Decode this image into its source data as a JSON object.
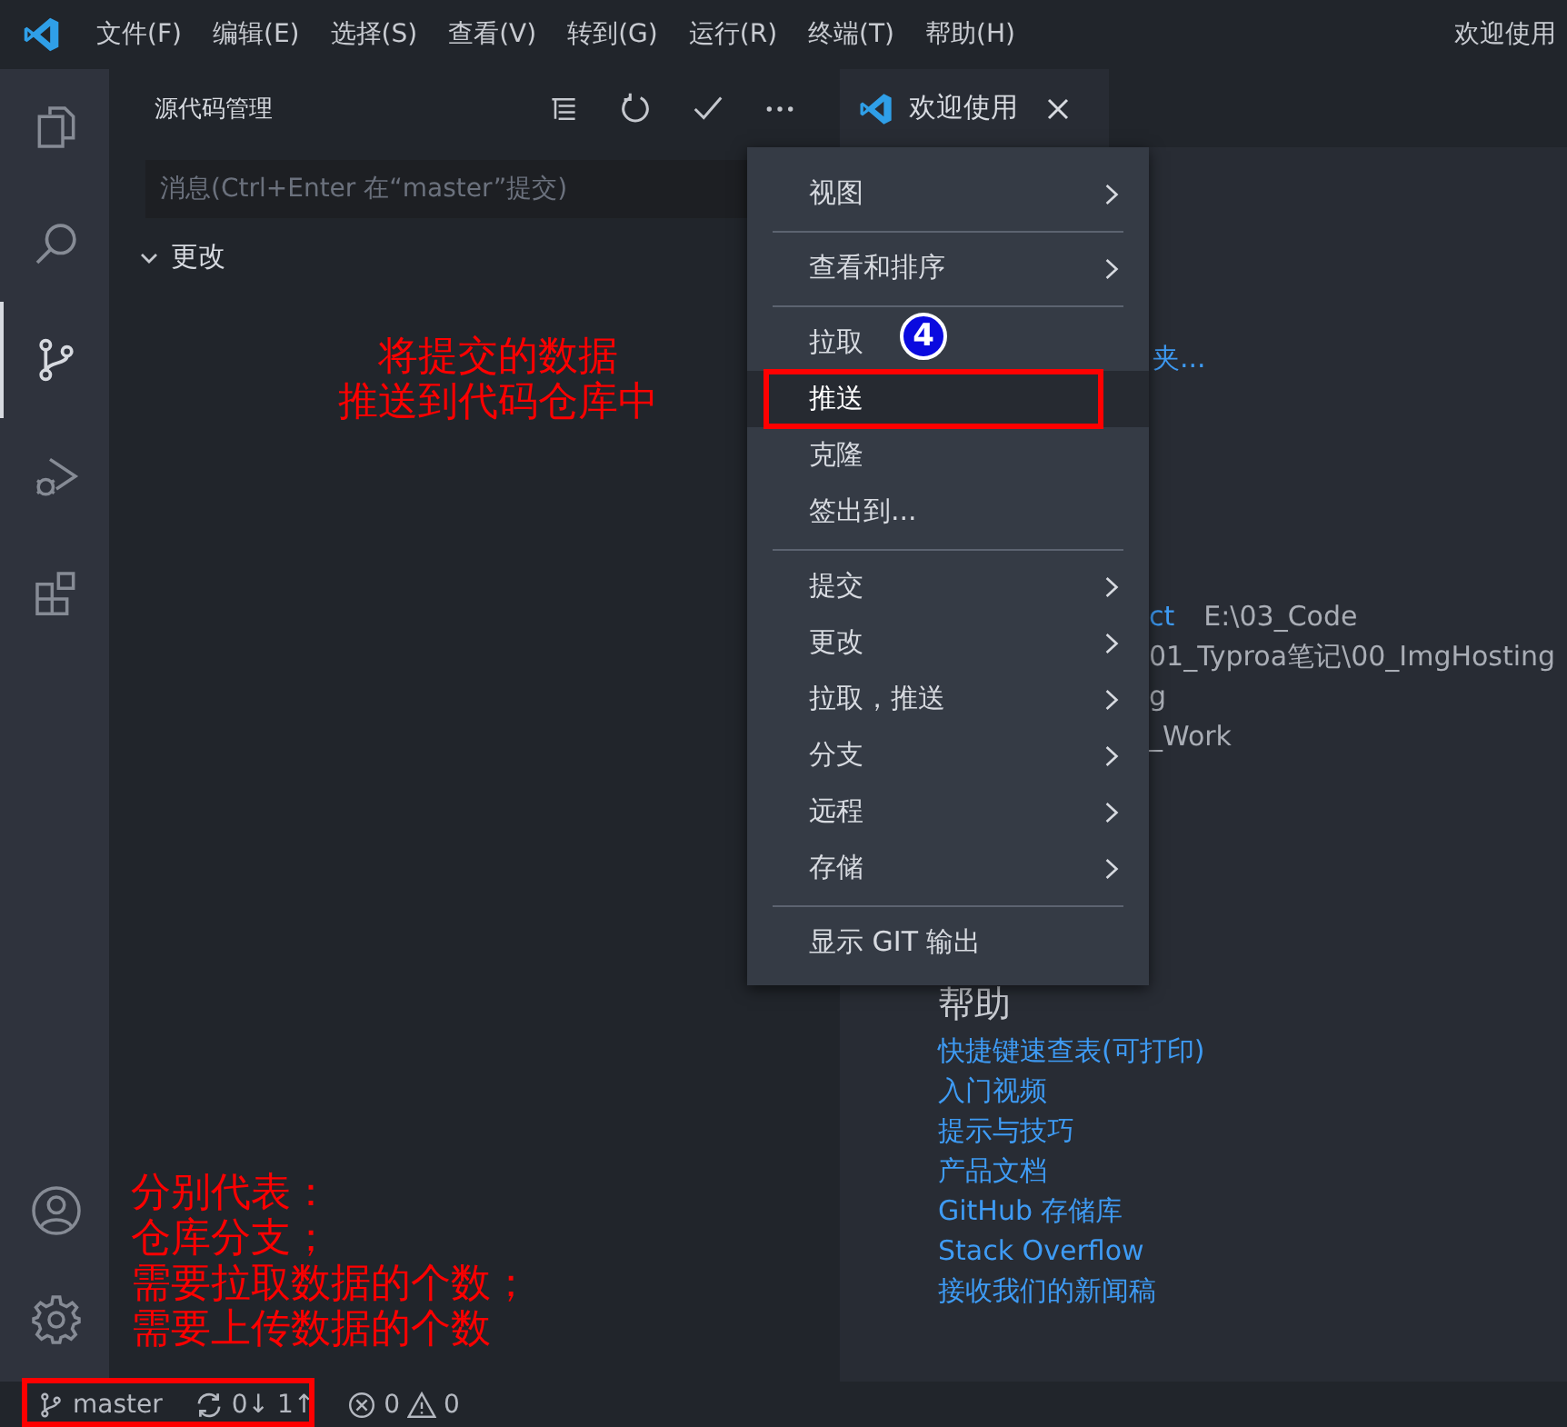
{
  "menu_bar": {
    "items": [
      "文件(F)",
      "编辑(E)",
      "选择(S)",
      "查看(V)",
      "转到(G)",
      "运行(R)",
      "终端(T)",
      "帮助(H)"
    ],
    "title": "欢迎使用"
  },
  "activity_bar": {
    "items": [
      {
        "kind": "files",
        "selected": false
      },
      {
        "kind": "search",
        "selected": false
      },
      {
        "kind": "source-control",
        "selected": true
      },
      {
        "kind": "run",
        "selected": false
      },
      {
        "kind": "extensions",
        "selected": false
      }
    ],
    "bottom": [
      {
        "kind": "account"
      },
      {
        "kind": "settings"
      }
    ]
  },
  "sidebar": {
    "title": "源代码管理",
    "message_field": {
      "placeholder": "消息(Ctrl+Enter 在“master”提交)"
    },
    "section": {
      "label": "更改",
      "expanded": true
    }
  },
  "editor": {
    "tab": {
      "label": "欢迎使用"
    },
    "open_link": "夹...",
    "recent": [
      {
        "name": "ct",
        "path": "E:\\03_Code"
      },
      {
        "path": "01_Typroa笔记\\00_ImgHosting"
      },
      {
        "path": "g"
      },
      {
        "path": "_Work"
      }
    ],
    "help": {
      "title": "帮助",
      "links": [
        "快捷键速查表(可打印)",
        "入门视频",
        "提示与技巧",
        "产品文档",
        "GitHub 存储库",
        "Stack Overflow",
        "接收我们的新闻稿"
      ]
    }
  },
  "context_menu": {
    "items": [
      {
        "kind": "item",
        "label": "视图",
        "submenu": true,
        "selected": false
      },
      {
        "kind": "separator"
      },
      {
        "kind": "item",
        "label": "查看和排序",
        "submenu": true,
        "selected": false
      },
      {
        "kind": "separator"
      },
      {
        "kind": "item",
        "label": "拉取",
        "submenu": false,
        "selected": false
      },
      {
        "kind": "item",
        "label": "推送",
        "submenu": false,
        "selected": true
      },
      {
        "kind": "item",
        "label": "克隆",
        "submenu": false,
        "selected": false
      },
      {
        "kind": "item",
        "label": "签出到...",
        "submenu": false,
        "selected": false
      },
      {
        "kind": "separator"
      },
      {
        "kind": "item",
        "label": "提交",
        "submenu": true,
        "selected": false
      },
      {
        "kind": "item",
        "label": "更改",
        "submenu": true,
        "selected": false
      },
      {
        "kind": "item",
        "label": "拉取，推送",
        "submenu": true,
        "selected": false
      },
      {
        "kind": "item",
        "label": "分支",
        "submenu": true,
        "selected": false
      },
      {
        "kind": "item",
        "label": "远程",
        "submenu": true,
        "selected": false
      },
      {
        "kind": "item",
        "label": "存储",
        "submenu": true,
        "selected": false
      },
      {
        "kind": "separator"
      },
      {
        "kind": "item",
        "label": "显示 GIT 输出",
        "submenu": false,
        "selected": false
      }
    ]
  },
  "annotations": {
    "step_badge": "4",
    "push_note": [
      "将提交的数据",
      "推送到代码仓库中"
    ],
    "status_note": [
      "分别代表：",
      "仓库分支；",
      "需要拉取数据的个数；",
      "需要上传数据的个数"
    ]
  },
  "status_bar": {
    "branch": "master",
    "sync": "0↓ 1↑",
    "errors": "0",
    "warnings": "0"
  }
}
